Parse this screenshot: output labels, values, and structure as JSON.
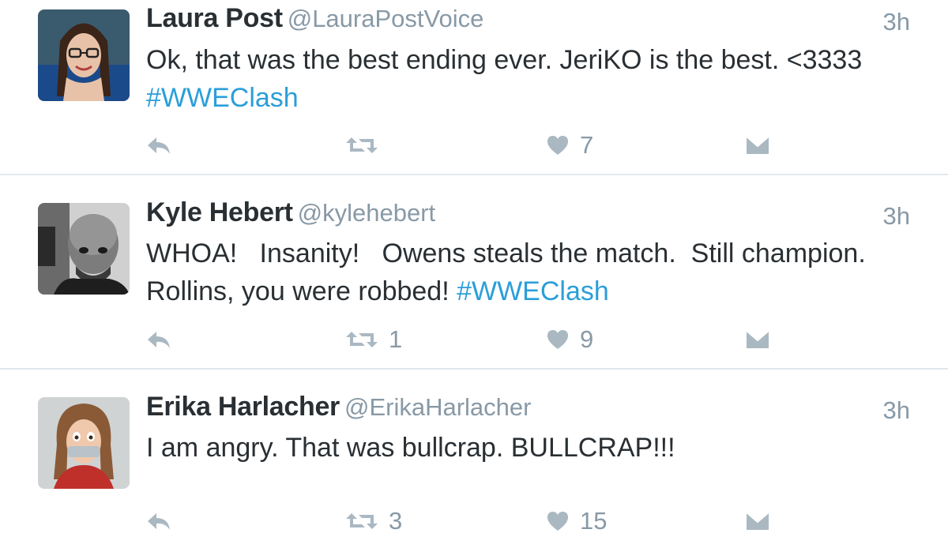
{
  "tweets": [
    {
      "name": "Laura Post",
      "handle": "@LauraPostVoice",
      "time": "3h",
      "text_line1": "Ok, that was the best ending ever. JeriKO is the best. <3333",
      "text_line2_plain": "",
      "hashtag": "#WWEClash",
      "retweets": "",
      "likes": "7",
      "avatar_icon": "avatar-laura-post"
    },
    {
      "name": "Kyle Hebert",
      "handle": "@kylehebert",
      "time": "3h",
      "text_line1": "WHOA!   Insanity!   Owens steals the match.  Still champion.",
      "text_line2_plain": "Rollins, you were robbed! ",
      "hashtag": "#WWEClash",
      "retweets": "1",
      "likes": "9",
      "avatar_icon": "avatar-kyle-hebert"
    },
    {
      "name": "Erika Harlacher",
      "handle": "@ErikaHarlacher",
      "time": "3h",
      "text_line1": "I am angry. That was bullcrap. BULLCRAP!!!",
      "retweets": "3",
      "likes": "15",
      "avatar_icon": "avatar-erika-harlacher"
    }
  ],
  "icons": {
    "reply": "reply-icon",
    "retweet": "retweet-icon",
    "like": "heart-icon",
    "dm": "direct-message-icon"
  },
  "colors": {
    "hashtag": "#2b9ed9",
    "action_icon": "#aab8c2",
    "secondary_text": "#8899a6",
    "primary_text": "#292f33",
    "divider": "#e1e8ed"
  }
}
